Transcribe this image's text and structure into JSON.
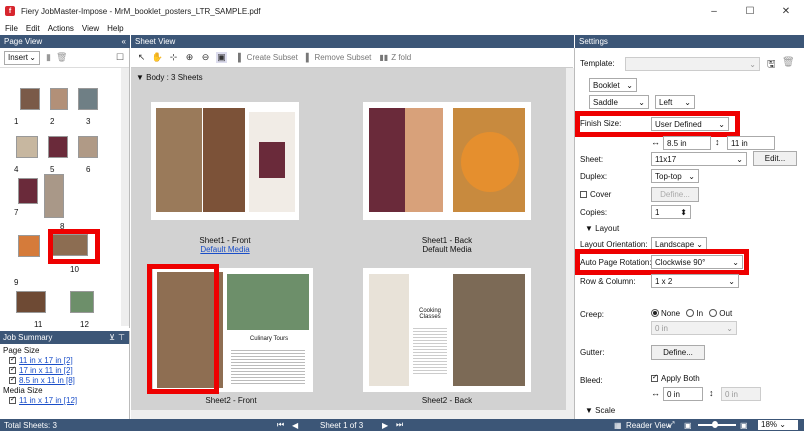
{
  "window": {
    "title": "Fiery JobMaster-Impose - MrM_booklet_posters_LTR_SAMPLE.pdf",
    "minimize": "–",
    "maximize": "☐",
    "close": "✕"
  },
  "menu": [
    "File",
    "Edit",
    "Actions",
    "View",
    "Help"
  ],
  "page_view": {
    "header": "Page View",
    "collapse": "«",
    "insert_label": "Insert",
    "thumbnails": [
      "1",
      "2",
      "3",
      "4",
      "5",
      "6",
      "7",
      "8",
      "9",
      "10",
      "11",
      "12"
    ]
  },
  "job_summary": {
    "header": "Job Summary",
    "page_size_label": "Page Size",
    "page_sizes": [
      "11 in x 17 in [2]",
      "17 in x 11 in [2]",
      "8.5 in x 11 in [8]"
    ],
    "media_size_label": "Media Size",
    "media_sizes": [
      "11 in x 17 in [12]"
    ]
  },
  "sheet_view": {
    "header": "Sheet View",
    "create_subset": "Create Subset",
    "remove_subset": "Remove Subset",
    "z_fold": "Z fold",
    "body_label": "Body : 3 Sheets",
    "sheets": [
      {
        "caption": "Sheet1 - Front",
        "media": "Default Media"
      },
      {
        "caption": "Sheet1 - Back",
        "media": "Default Media"
      },
      {
        "caption": "Sheet2 - Front",
        "media": ""
      },
      {
        "caption": "Sheet2 - Back",
        "media": ""
      }
    ],
    "sheet_text": {
      "culinary_tours": "Culinary Tours",
      "cooking_classes": "Cooking Classes"
    }
  },
  "settings": {
    "header": "Settings",
    "template_label": "Template:",
    "booklet": "Booklet",
    "saddle": "Saddle",
    "left": "Left",
    "finish_size_label": "Finish Size:",
    "finish_size_value": "User Defined",
    "width_value": "8.5 in",
    "height_value": "11 in",
    "sheet_label": "Sheet:",
    "sheet_value": "11x17",
    "edit_button": "Edit...",
    "duplex_label": "Duplex:",
    "duplex_value": "Top-top",
    "cover_label": "Cover",
    "define_button": "Define...",
    "copies_label": "Copies:",
    "copies_value": "1",
    "layout_section": "Layout",
    "layout_orientation_label": "Layout Orientation:",
    "layout_orientation_value": "Landscape",
    "auto_rotation_label": "Auto Page Rotation:",
    "auto_rotation_value": "Clockwise 90°",
    "row_column_label": "Row & Column:",
    "row_column_value": "1 x 2",
    "creep_label": "Creep:",
    "creep_none": "None",
    "creep_in": "In",
    "creep_out": "Out",
    "creep_value": "0 in",
    "gutter_label": "Gutter:",
    "gutter_define": "Define...",
    "bleed_label": "Bleed:",
    "apply_both": "Apply Both",
    "bleed_value1": "0 in",
    "bleed_value2": "0 in",
    "scale_section": "Scale"
  },
  "status": {
    "total_sheets": "Total Sheets: 3",
    "sheet_of": "Sheet 1 of 3",
    "reader_view": "Reader View",
    "zoom": "18%"
  },
  "colors": {
    "header_bg": "#3c5677",
    "highlight": "#ee0000",
    "link": "#1a4ec8"
  }
}
